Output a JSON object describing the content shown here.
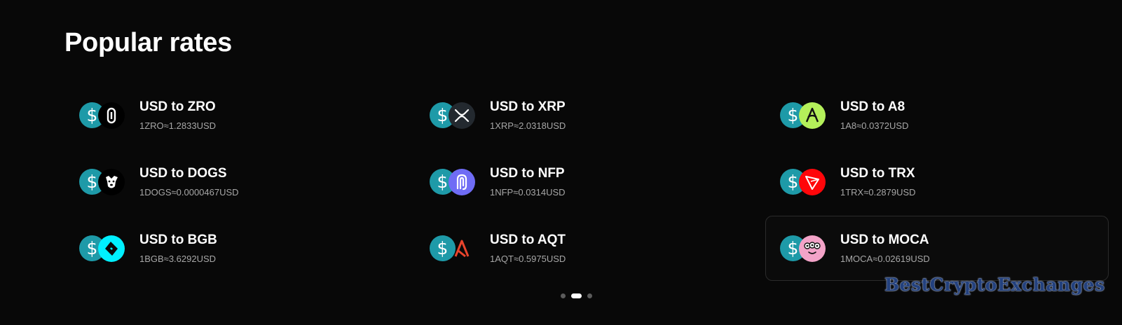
{
  "section": {
    "title": "Popular rates"
  },
  "rates": [
    {
      "title": "USD to ZRO",
      "subtitle": "1ZRO≈1.2833USD",
      "icon": "zro-icon",
      "color": "#000000"
    },
    {
      "title": "USD to XRP",
      "subtitle": "1XRP≈2.0318USD",
      "icon": "xrp-icon",
      "color": "#23292f"
    },
    {
      "title": "USD to A8",
      "subtitle": "1A8≈0.0372USD",
      "icon": "a8-icon",
      "color": "#b4f05a"
    },
    {
      "title": "USD to DOGS",
      "subtitle": "1DOGS≈0.0000467USD",
      "icon": "dogs-icon",
      "color": "#000000"
    },
    {
      "title": "USD to NFP",
      "subtitle": "1NFP≈0.0314USD",
      "icon": "nfp-icon",
      "color": "#6f6cf5"
    },
    {
      "title": "USD to TRX",
      "subtitle": "1TRX≈0.2879USD",
      "icon": "trx-icon",
      "color": "#ff060a"
    },
    {
      "title": "USD to BGB",
      "subtitle": "1BGB≈3.6292USD",
      "icon": "bgb-icon",
      "color": "#00f0ff"
    },
    {
      "title": "USD to AQT",
      "subtitle": "1AQT≈0.5975USD",
      "icon": "aqt-icon",
      "color": "#e8442c"
    },
    {
      "title": "USD to MOCA",
      "subtitle": "1MOCA≈0.02619USD",
      "icon": "moca-icon",
      "color": "#f3a3c8"
    }
  ],
  "pagination": {
    "pages": 3,
    "current": 2
  },
  "watermark": "BestCryptoExchanges",
  "colors": {
    "background": "#080808",
    "usd_badge": "#1e9aa8",
    "subtitle_text": "#a7a7a7"
  }
}
